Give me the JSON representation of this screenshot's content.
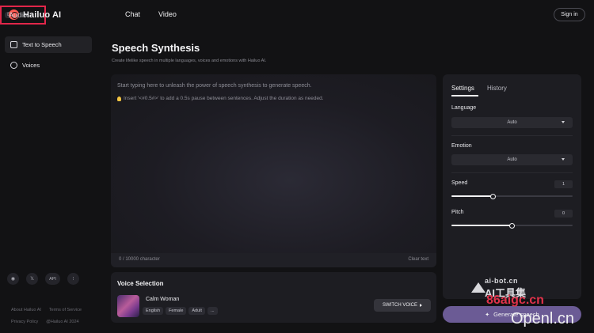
{
  "brand": {
    "name": "Hailuo AI"
  },
  "nav": {
    "audio_label": "Audio",
    "beta_badge": "Beta",
    "chat_label": "Chat",
    "video_label": "Video",
    "sign_in": "Sign in"
  },
  "sidebar": {
    "items": [
      {
        "label": "Text to Speech",
        "icon": "text-to-speech-icon",
        "active": true
      },
      {
        "label": "Voices",
        "icon": "voices-icon",
        "active": false
      }
    ],
    "social": {
      "api_label": "API"
    },
    "footer": {
      "about": "About Hailuo AI",
      "terms": "Terms of Service",
      "privacy": "Privacy Policy",
      "copyright": "@Hailuo AI 2024"
    }
  },
  "main": {
    "title": "Speech Synthesis",
    "subtitle": "Create lifelike speech in multiple languages, voices and emotions with Hailuo AI.",
    "editor": {
      "placeholder": "Start typing here to unleash the power of speech synthesis to generate speech.",
      "tip": "Insert '<#0.5#>' to add a 0.5s pause between sentences. Adjust the duration as needed.",
      "char_count": "0 / 10000 character",
      "clear_label": "Clear text"
    },
    "voice_selection": {
      "title": "Voice Selection",
      "voice_name": "Calm Woman",
      "tags": [
        "English",
        "Female",
        "Adult",
        "..."
      ],
      "switch_label": "SWITCH VOICE"
    }
  },
  "settings": {
    "tabs": {
      "settings": "Settings",
      "history": "History"
    },
    "language": {
      "label": "Language",
      "value": "Auto"
    },
    "emotion": {
      "label": "Emotion",
      "value": "Auto"
    },
    "speed": {
      "label": "Speed",
      "value": "1",
      "fraction": 0.34
    },
    "pitch": {
      "label": "Pitch",
      "value": "0",
      "fraction": 0.5
    },
    "generate_label": "Generate speech"
  },
  "watermark": {
    "line1": "ai-bot.cn",
    "line2": "AI工具集",
    "line3": "86aigc.cn",
    "line4": "Openl.cn"
  }
}
